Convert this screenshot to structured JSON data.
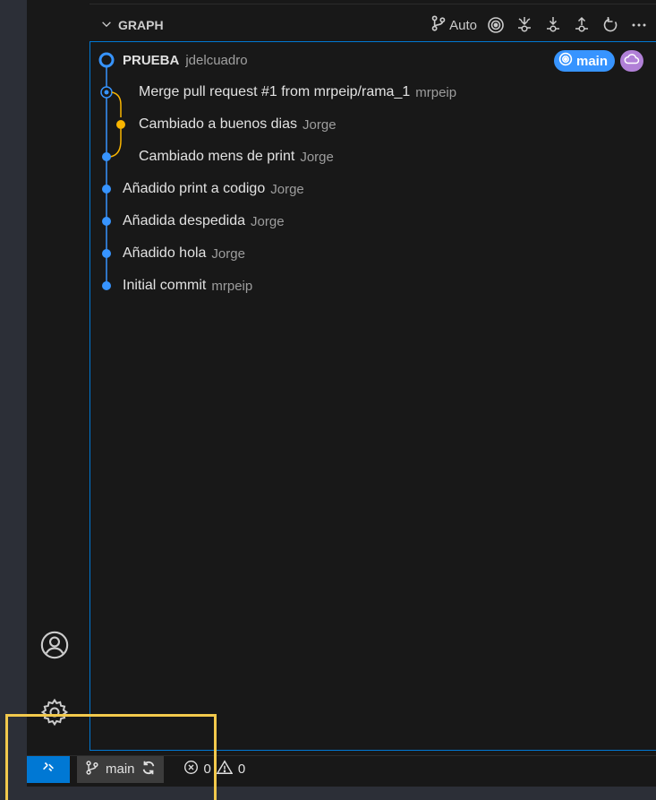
{
  "graph": {
    "title": "GRAPH",
    "mode_label": "Auto",
    "repo": {
      "name": "PRUEBA",
      "owner": "jdelcuadro",
      "branch": "main"
    },
    "commits": [
      {
        "message": "Merge pull request #1 from mrpeip/rama_1",
        "author": "mrpeip"
      },
      {
        "message": "Cambiado a  buenos dias",
        "author": "Jorge"
      },
      {
        "message": "Cambiado mens de print",
        "author": "Jorge"
      },
      {
        "message": "Añadido print a codigo",
        "author": "Jorge"
      },
      {
        "message": "Añadida despedida",
        "author": "Jorge"
      },
      {
        "message": "Añadido hola",
        "author": "Jorge"
      },
      {
        "message": "Initial commit",
        "author": "mrpeip"
      }
    ]
  },
  "statusbar": {
    "branch": "main",
    "errors": "0",
    "warnings": "0"
  },
  "colors": {
    "accent": "#0078d4",
    "graph_blue": "#3794ff",
    "graph_yellow": "#f9b500",
    "highlight": "#f2c94c"
  }
}
